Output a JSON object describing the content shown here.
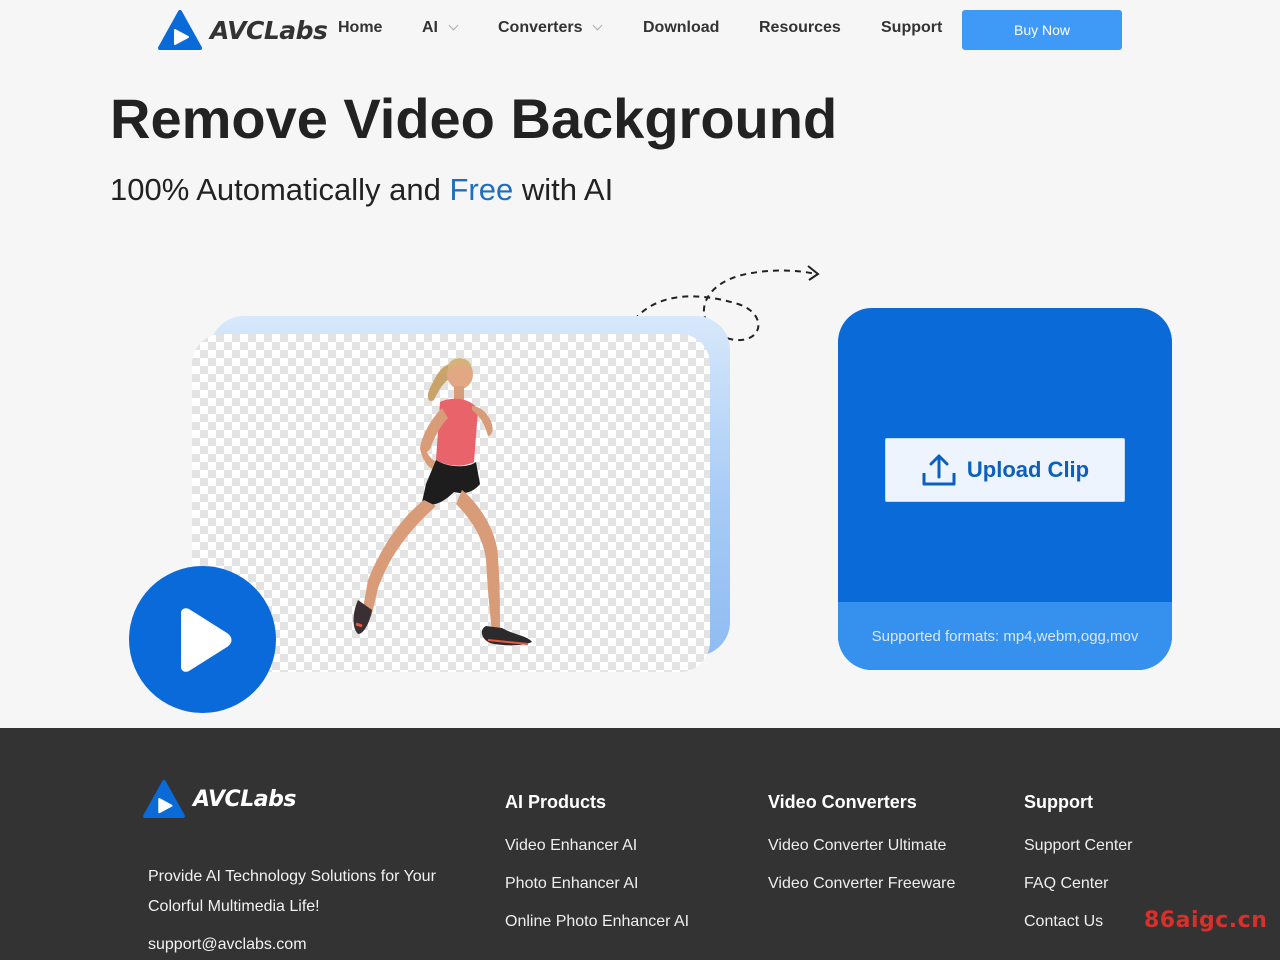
{
  "header": {
    "brand": "AVCLabs",
    "nav": [
      {
        "label": "Home",
        "dropdown": false
      },
      {
        "label": "AI",
        "dropdown": true
      },
      {
        "label": "Converters",
        "dropdown": true
      },
      {
        "label": "Download",
        "dropdown": false
      },
      {
        "label": "Resources",
        "dropdown": false
      },
      {
        "label": "Support",
        "dropdown": false
      }
    ],
    "buy_label": "Buy Now"
  },
  "hero": {
    "title": "Remove Video Background",
    "subtitle_pre": "100% Automatically and ",
    "subtitle_accent": "Free",
    "subtitle_post": " with AI"
  },
  "upload": {
    "button_label": "Upload Clip",
    "formats": "Supported formats: mp4,webm,ogg,mov"
  },
  "footer": {
    "brand": "AVCLabs",
    "tagline": "Provide AI Technology Solutions for Your Colorful Multimedia Life!",
    "email": "support@avclabs.com",
    "columns": [
      {
        "title": "AI Products",
        "links": [
          "Video Enhancer AI",
          "Photo Enhancer AI",
          "Online Photo Enhancer AI"
        ]
      },
      {
        "title": "Video Converters",
        "links": [
          "Video Converter Ultimate",
          "Video Converter Freeware"
        ]
      },
      {
        "title": "Support",
        "links": [
          "Support Center",
          "FAQ Center",
          "Contact Us"
        ]
      }
    ]
  },
  "watermark": "86aigc.cn",
  "colors": {
    "brand_blue": "#0a6ad8",
    "buy_button": "#3f99f7",
    "accent_text": "#1f6fbf",
    "footer_bg": "#333333",
    "watermark": "#d8302a"
  },
  "icons": [
    "avclabs-logo-icon",
    "chevron-down-icon",
    "play-icon",
    "upload-icon",
    "dashed-arrow-icon"
  ]
}
